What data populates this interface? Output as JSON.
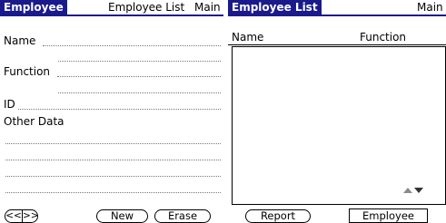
{
  "employee_form": {
    "tab_title": "Employee",
    "menu_list": "Employee List",
    "menu_main": "Main",
    "name_label": "Name",
    "function_label": "Function",
    "id_label": "ID",
    "other_data_label": "Other Data",
    "nav_prev_label": "<<",
    "nav_next_label": ">>",
    "new_button": "New",
    "erase_button": "Erase"
  },
  "employee_list": {
    "tab_title": "Employee List",
    "menu_main": "Main",
    "columns": [
      "Name",
      "Function"
    ],
    "rows": [],
    "report_button": "Report",
    "employee_button": "Employee"
  },
  "colors": {
    "title_bar": "#1a1a8c"
  },
  "icons": {
    "scroll_up": "triangle-up-icon",
    "scroll_down": "triangle-down-icon"
  }
}
